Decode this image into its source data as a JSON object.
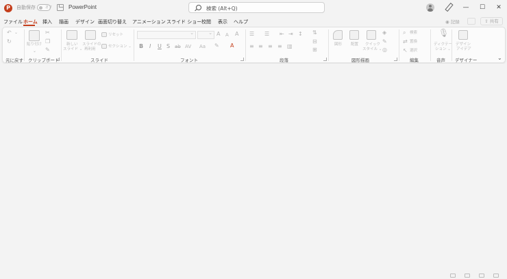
{
  "titlebar": {
    "autosave_label": "自動保存",
    "autosave_state": "オフ",
    "app_name": "PowerPoint",
    "search_placeholder": "検索 (Alt+Q)",
    "minimize": "—",
    "maximize": "☐",
    "close": "✕"
  },
  "tabs": [
    "ファイル",
    "ホーム",
    "挿入",
    "描画",
    "デザイン",
    "画面切り替え",
    "アニメーション",
    "スライド ショー",
    "校閲",
    "表示",
    "ヘルプ"
  ],
  "active_tab": "ホーム",
  "tabs_right": {
    "record": "記録",
    "share": "共有"
  },
  "ribbon": {
    "undo_group": {
      "label": "元に戻す"
    },
    "clipboard": {
      "label": "クリップボード",
      "paste": "貼り付け"
    },
    "slides": {
      "label": "スライド",
      "new_slide_1": "新しい",
      "new_slide_2": "スライド ⌄",
      "reuse_1": "スライドの",
      "reuse_2": "再利用",
      "reset": "リセット",
      "section": "セクション ⌄"
    },
    "font": {
      "label": "フォント",
      "bold": "B",
      "italic": "I",
      "underline": "U",
      "shadow": "S",
      "strike": "ab",
      "spacing": "AV",
      "case": "Aa",
      "grow": "A",
      "shrink": "A",
      "clear": "A"
    },
    "paragraph": {
      "label": "段落"
    },
    "drawing": {
      "label": "図形描画",
      "shapes": "図形",
      "arrange": "配置",
      "quick_style_1": "クイック",
      "quick_style_2": "スタイル ⌄"
    },
    "editing": {
      "label": "編集",
      "find": "検索",
      "replace": "置換",
      "select": "選択"
    },
    "voice": {
      "label": "音声",
      "dictate_1": "ディクテー",
      "dictate_2": "ション ⌄"
    },
    "designer": {
      "label": "デザイナー",
      "designer_1": "デザイン",
      "designer_2": "アイデア"
    }
  },
  "colors": {
    "accent": "#c43e1c",
    "background": "#f3f3f3",
    "ribbon": "#fbfbfb"
  }
}
